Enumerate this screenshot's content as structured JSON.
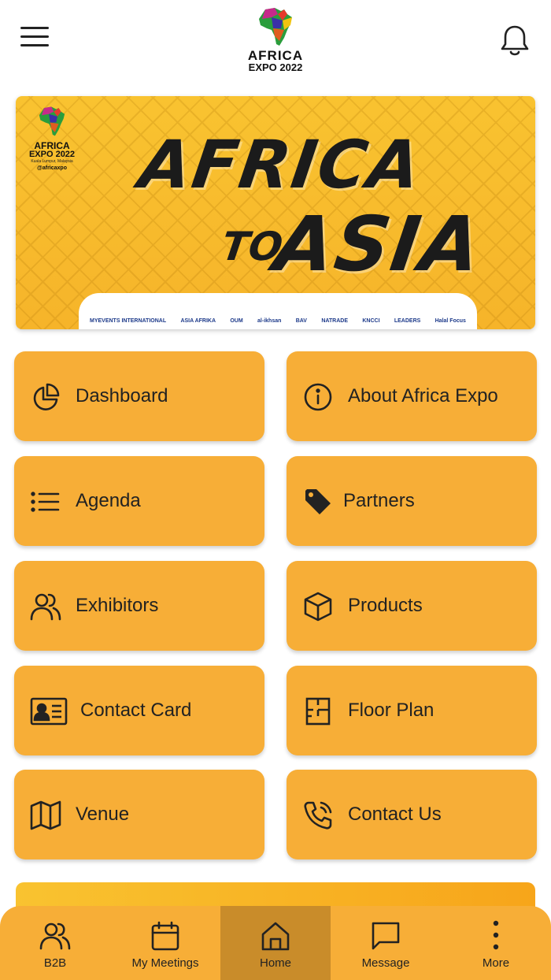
{
  "header": {
    "logo_line1": "AFRICA",
    "logo_line2": "EXPO 2022"
  },
  "banner": {
    "logo_line1": "AFRICA",
    "logo_line2": "EXPO 2022",
    "logo_location": "Kuala Lumpur, Malaysia",
    "logo_social": "@africaxpo",
    "title_line1": "AFRICA",
    "title_to": "TO",
    "title_line2": "ASIA",
    "sponsors": [
      "MYEVENTS INTERNATIONAL",
      "ASIA AFRIKA",
      "OUM",
      "al-ikhsan",
      "BAV",
      "NATRADE",
      "KNCCI",
      "LEADERS",
      "Halal Focus"
    ]
  },
  "menu": [
    {
      "label": "Dashboard",
      "icon": "pie-chart-icon"
    },
    {
      "label": "About Africa Expo",
      "icon": "info-icon"
    },
    {
      "label": "Agenda",
      "icon": "list-icon"
    },
    {
      "label": "Partners",
      "icon": "tag-icon"
    },
    {
      "label": "Exhibitors",
      "icon": "users-icon"
    },
    {
      "label": "Products",
      "icon": "box-icon"
    },
    {
      "label": "Contact Card",
      "icon": "id-card-icon"
    },
    {
      "label": "Floor Plan",
      "icon": "floor-plan-icon"
    },
    {
      "label": "Venue",
      "icon": "map-icon"
    },
    {
      "label": "Contact Us",
      "icon": "phone-icon"
    }
  ],
  "nav": [
    {
      "label": "B2B",
      "icon": "users-icon"
    },
    {
      "label": "My Meetings",
      "icon": "calendar-icon"
    },
    {
      "label": "Home",
      "icon": "home-icon",
      "active": true
    },
    {
      "label": "Message",
      "icon": "message-icon"
    },
    {
      "label": "More",
      "icon": "more-icon"
    }
  ],
  "colors": {
    "tile": "#f7ae37",
    "nav_active": "#c98c2a",
    "banner": "#f9c330"
  }
}
